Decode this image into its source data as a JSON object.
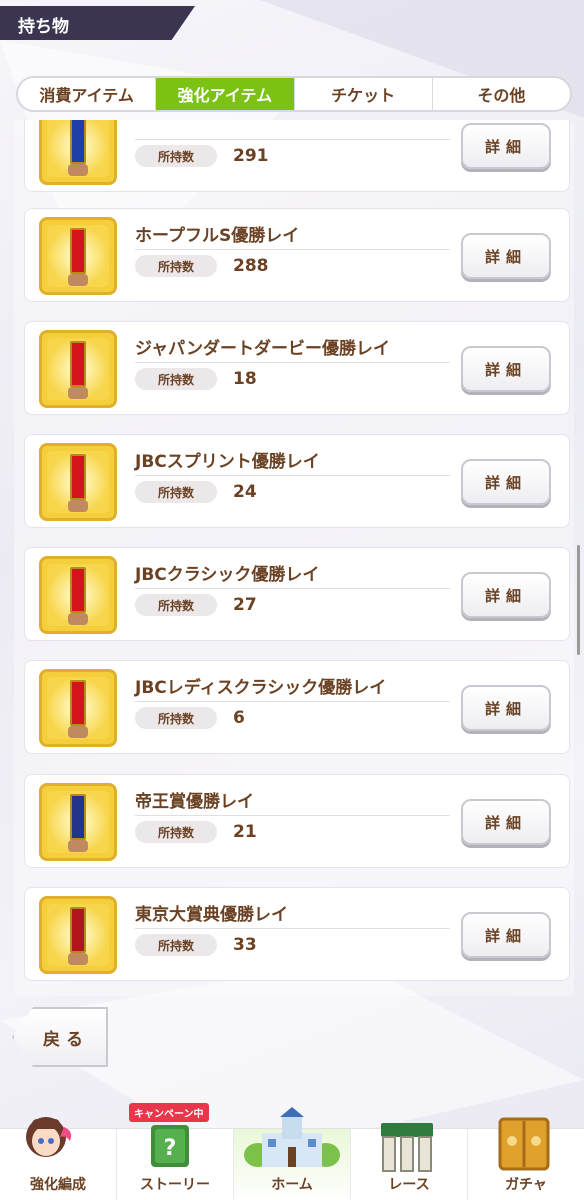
{
  "header": {
    "title": "持ち物"
  },
  "tabs": [
    {
      "label": "消費アイテム",
      "active": false
    },
    {
      "label": "強化アイテム",
      "active": true
    },
    {
      "label": "チケット",
      "active": false
    },
    {
      "label": "その他",
      "active": false
    }
  ],
  "list": {
    "qty_label": "所持数",
    "detail_label": "詳細",
    "items": [
      {
        "name": "",
        "qty": "291",
        "lei_color": "#1f3fa8"
      },
      {
        "name": "ホープフルS優勝レイ",
        "qty": "288",
        "lei_color": "#d3151b"
      },
      {
        "name": "ジャパンダートダービー優勝レイ",
        "qty": "18",
        "lei_color": "#d3151b"
      },
      {
        "name": "JBCスプリント優勝レイ",
        "qty": "24",
        "lei_color": "#d3151b"
      },
      {
        "name": "JBCクラシック優勝レイ",
        "qty": "27",
        "lei_color": "#d3151b"
      },
      {
        "name": "JBCレディスクラシック優勝レイ",
        "qty": "6",
        "lei_color": "#d3151b"
      },
      {
        "name": "帝王賞優勝レイ",
        "qty": "21",
        "lei_color": "#24348a"
      },
      {
        "name": "東京大賞典優勝レイ",
        "qty": "33",
        "lei_color": "#b2151b"
      }
    ]
  },
  "back_button": {
    "label": "戻る"
  },
  "bottom_nav": {
    "campaign_badge": "キャンペーン中",
    "items": [
      {
        "label": "強化編成",
        "icon": "horse-girl-icon"
      },
      {
        "label": "ストーリー",
        "icon": "story-book-icon"
      },
      {
        "label": "ホーム",
        "icon": "home-castle-icon"
      },
      {
        "label": "レース",
        "icon": "race-gate-icon"
      },
      {
        "label": "ガチャ",
        "icon": "gacha-door-icon"
      }
    ]
  },
  "colors": {
    "accent_green": "#7bc214",
    "text_brown": "#6b4224",
    "header_bg": "#3b3552",
    "thumb_gold": "#f4cf3b"
  }
}
